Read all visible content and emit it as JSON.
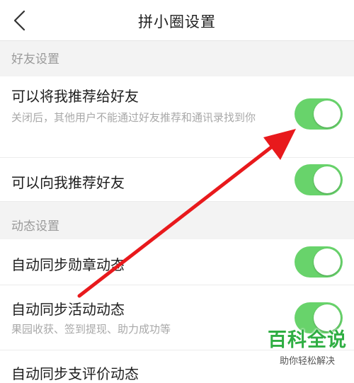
{
  "nav": {
    "title": "拼小圈设置"
  },
  "sections": [
    {
      "header": "好友设置"
    },
    {
      "header": "动态设置"
    }
  ],
  "rows": [
    {
      "title": "可以将我推荐给好友",
      "desc": "关闭后，其他用户不能通过好友推荐和通讯录找到你",
      "on": true
    },
    {
      "title": "可以向我推荐好友",
      "on": true
    },
    {
      "title": "自动同步勋章动态",
      "on": true
    },
    {
      "title": "自动同步活动动态",
      "desc": "果园收获、签到提现、助力成功等",
      "on": true
    },
    {
      "title": "自动同步支评价动态"
    }
  ],
  "watermark": {
    "main": "百科全说",
    "sub": "助你轻松解决"
  },
  "colors": {
    "toggle_on": "#68d36b",
    "annotation_arrow": "#e8191c",
    "section_bg": "#f3f3f3"
  }
}
